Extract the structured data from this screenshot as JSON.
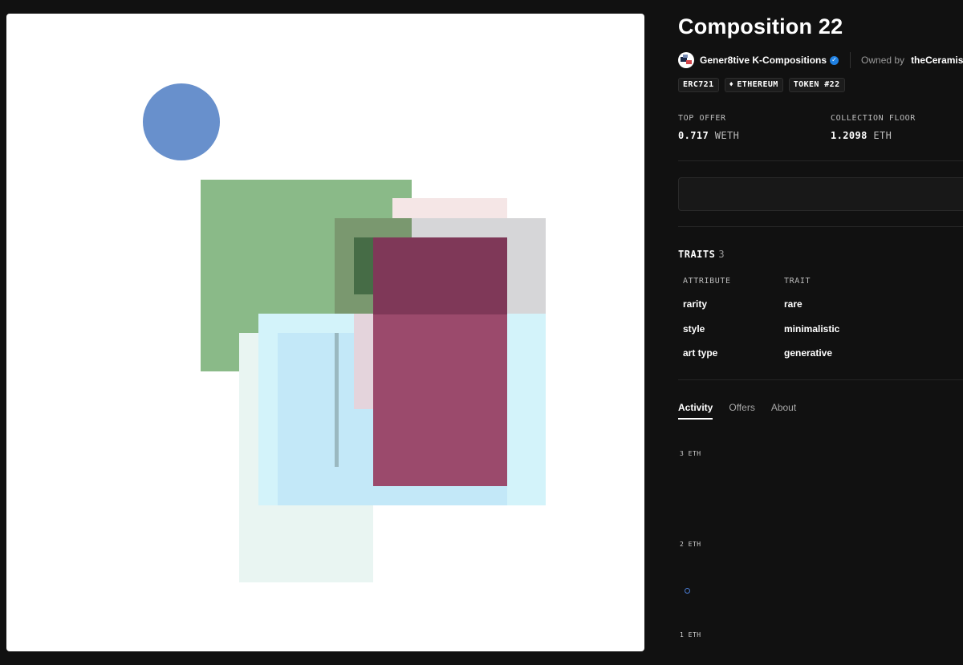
{
  "artwork": {
    "shapes": [
      {
        "kind": "circle",
        "color": "#6890cc"
      },
      {
        "kind": "rect",
        "color": "#8aba88"
      },
      {
        "kind": "rect",
        "color": "#f5e6e6"
      },
      {
        "kind": "rect",
        "color": "#d6d6d8"
      },
      {
        "kind": "rect",
        "color": "#7a986f"
      },
      {
        "kind": "rect",
        "color": "#e9f5f2"
      },
      {
        "kind": "rect",
        "color": "#d3f3fa"
      },
      {
        "kind": "rect",
        "color": "#c3e8f8"
      },
      {
        "kind": "rect",
        "color": "#e4d4dc"
      },
      {
        "kind": "rect",
        "color": "#9b4a6c"
      },
      {
        "kind": "rect",
        "color": "#7f3858"
      },
      {
        "kind": "rect",
        "color": "#466c46"
      },
      {
        "kind": "rect",
        "color": "#9ab8c0"
      }
    ]
  },
  "title": "Composition 22",
  "collection": {
    "name": "Gener8tive K-Compositions",
    "verified_icon": "verified-check-icon",
    "owned_by_label": "Owned by",
    "owner": "theCeramist"
  },
  "badges": {
    "standard": "ERC721",
    "chain": "ETHEREUM",
    "token": "TOKEN #22",
    "chain_icon": "ethereum-icon"
  },
  "stats": {
    "top_offer_label": "TOP OFFER",
    "top_offer_value": "0.717",
    "top_offer_unit": "WETH",
    "floor_label": "COLLECTION FLOOR",
    "floor_value": "1.2098",
    "floor_unit": "ETH"
  },
  "traits": {
    "heading": "TRAITS",
    "count": "3",
    "col_attribute": "ATTRIBUTE",
    "col_trait": "TRAIT",
    "rows": [
      {
        "attribute": "rarity",
        "trait": "rare"
      },
      {
        "attribute": "style",
        "trait": "minimalistic"
      },
      {
        "attribute": "art type",
        "trait": "generative"
      }
    ]
  },
  "tabs": [
    {
      "label": "Activity",
      "active": true
    },
    {
      "label": "Offers",
      "active": false
    },
    {
      "label": "About",
      "active": false
    }
  ],
  "chart_data": {
    "type": "scatter",
    "y_ticks": [
      "3 ETH",
      "2 ETH",
      "1 ETH"
    ],
    "ylim": [
      1,
      3
    ],
    "points": [
      {
        "y": 1.5
      }
    ],
    "point_color": "#4a7bd0"
  }
}
